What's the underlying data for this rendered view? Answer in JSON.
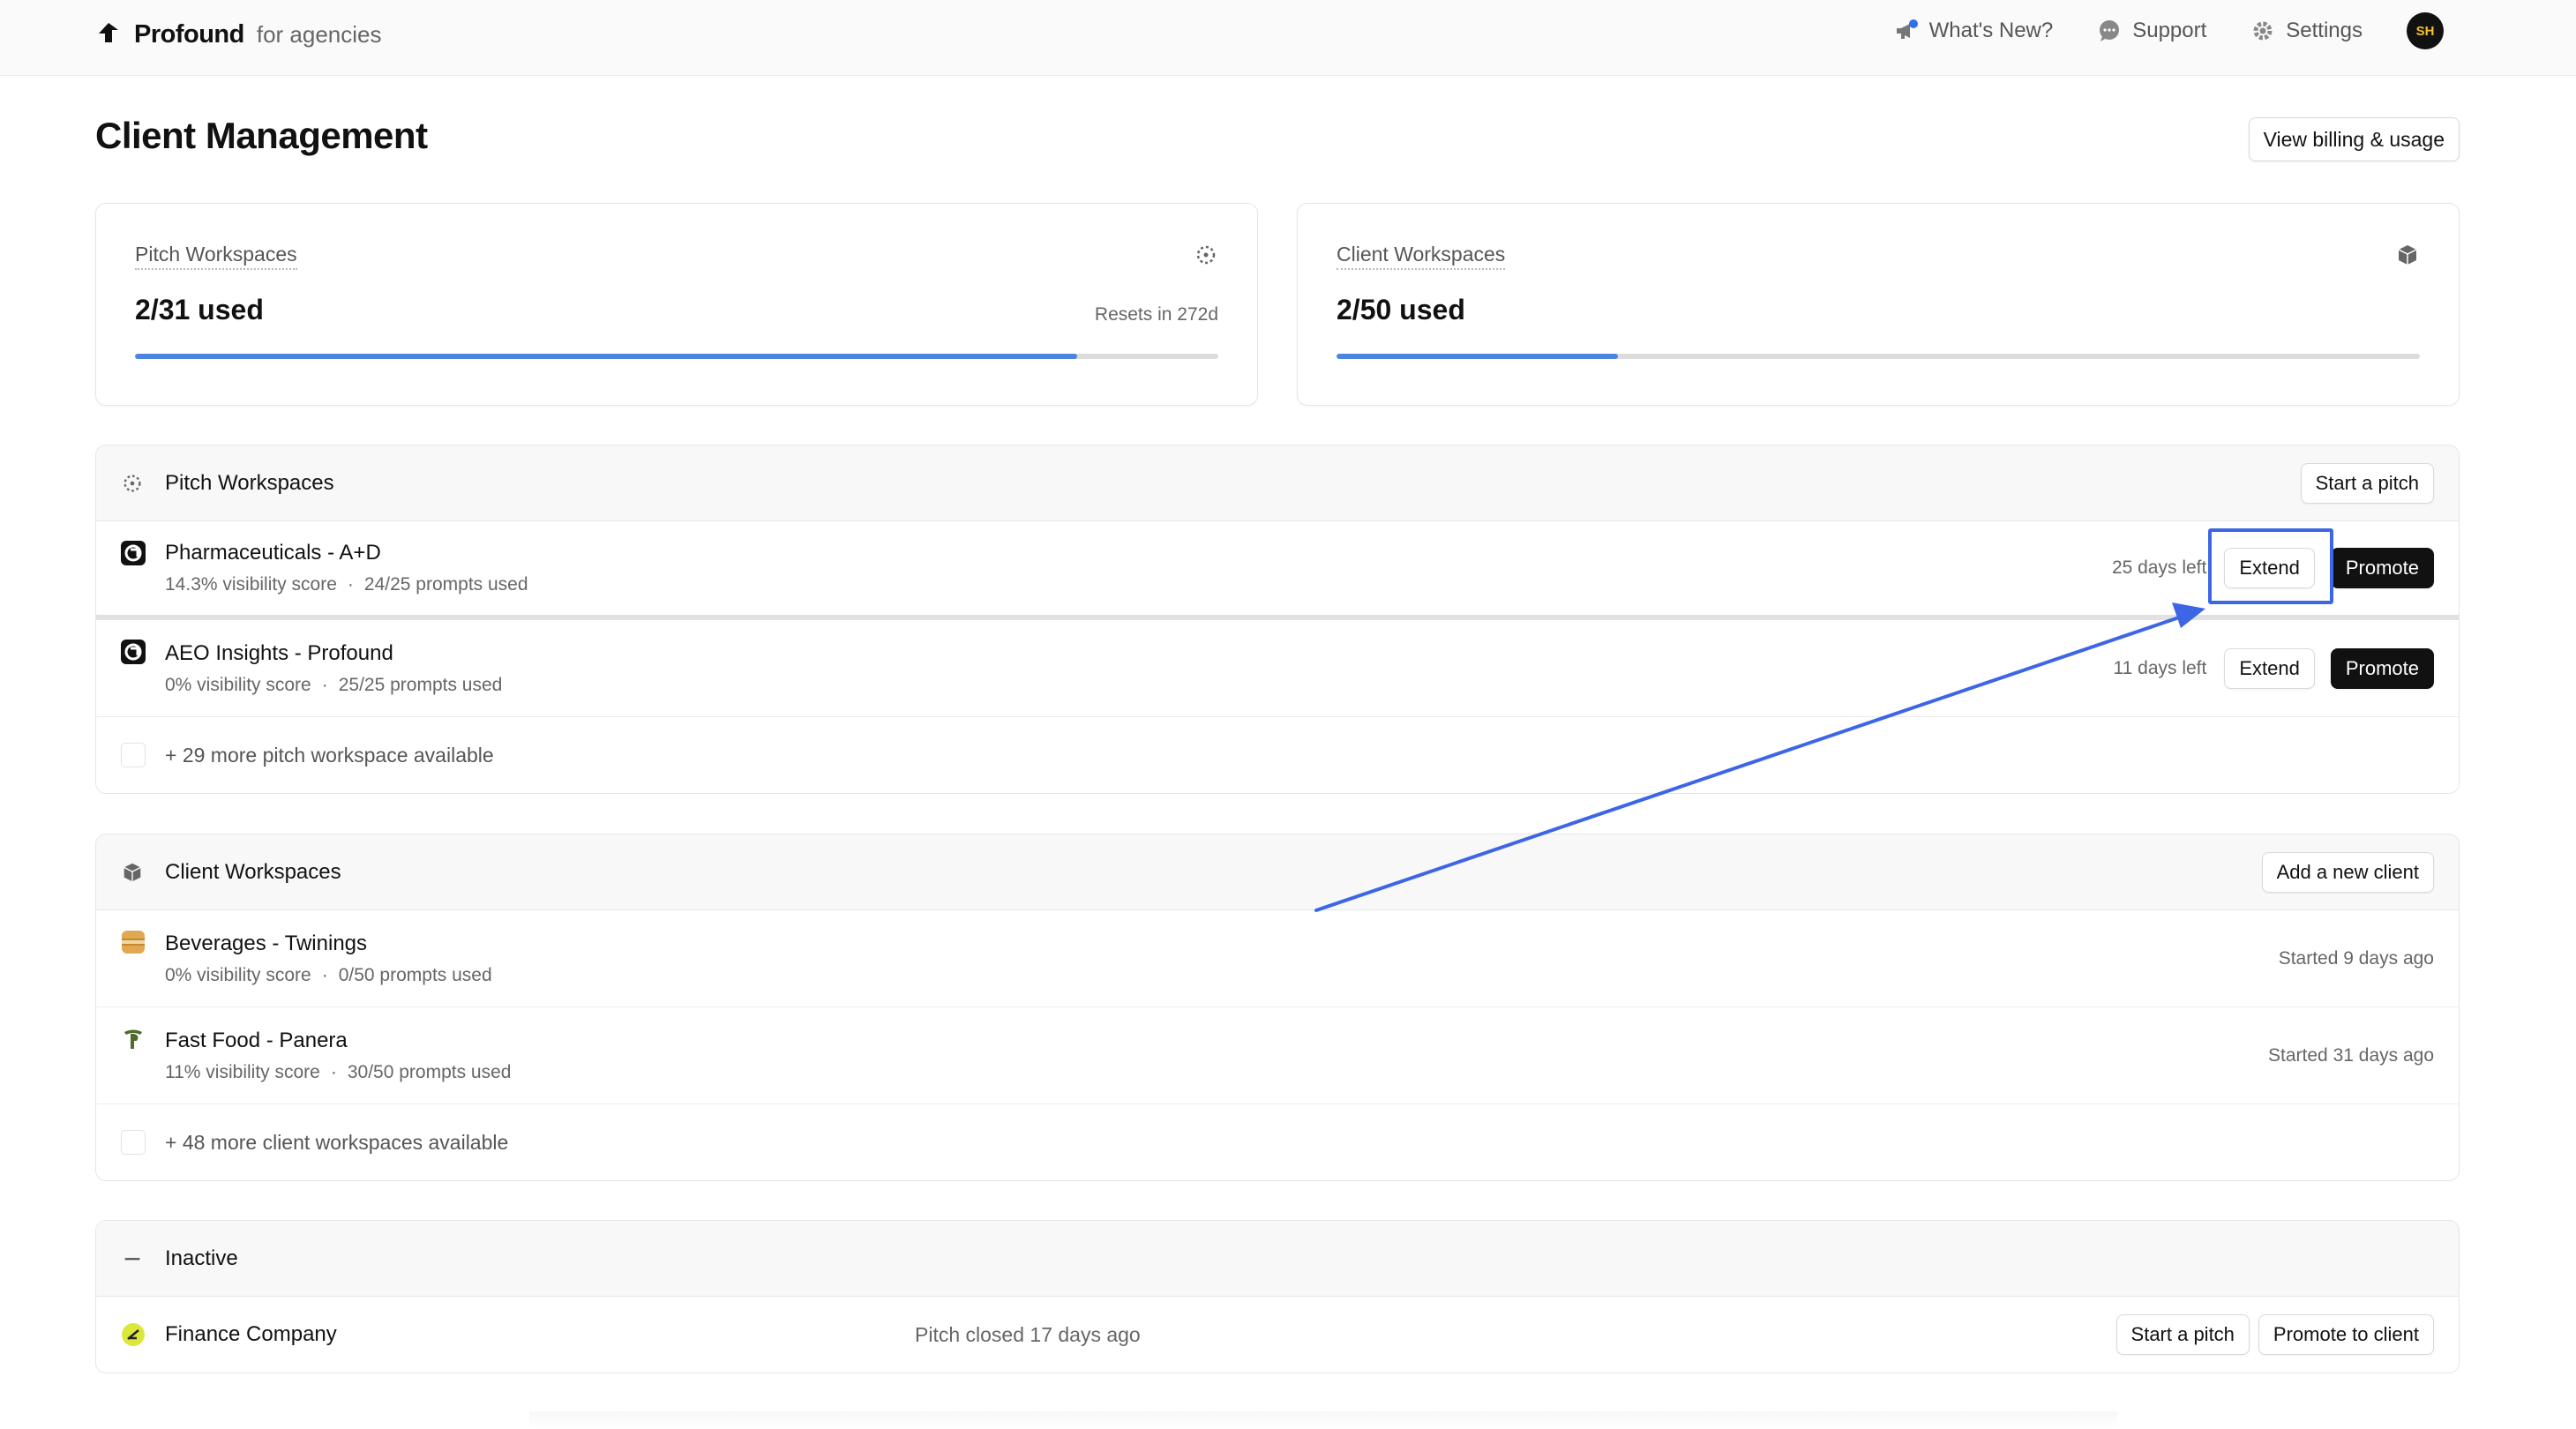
{
  "brand": {
    "name": "Profound",
    "sub": "for agencies"
  },
  "nav": {
    "whats_new": "What's New?",
    "support": "Support",
    "settings": "Settings",
    "avatar_initials": "SH"
  },
  "page": {
    "title": "Client Management",
    "billing_button": "View billing & usage"
  },
  "usage": {
    "pitch": {
      "title": "Pitch Workspaces",
      "value": "2/31 used",
      "reset": "Resets in 272d",
      "fill_percent": 87
    },
    "client": {
      "title": "Client Workspaces",
      "value": "2/50 used",
      "fill_percent": 26
    }
  },
  "pitch_section": {
    "title": "Pitch Workspaces",
    "action": "Start a pitch",
    "rows": [
      {
        "name": "Pharmaceuticals - A+D",
        "visibility": "14.3% visibility score",
        "prompts": "24/25 prompts used",
        "days_left": "25 days left",
        "extend": "Extend",
        "promote": "Promote"
      },
      {
        "name": "AEO Insights - Profound",
        "visibility": "0% visibility score",
        "prompts": "25/25 prompts used",
        "days_left": "11 days left",
        "extend": "Extend",
        "promote": "Promote"
      }
    ],
    "more": "+ 29 more pitch workspace available"
  },
  "client_section": {
    "title": "Client Workspaces",
    "action": "Add a new client",
    "rows": [
      {
        "name": "Beverages - Twinings",
        "visibility": "0% visibility score",
        "prompts": "0/50 prompts used",
        "started": "Started 9 days ago"
      },
      {
        "name": "Fast Food - Panera",
        "visibility": "11% visibility score",
        "prompts": "30/50 prompts used",
        "started": "Started 31 days ago"
      }
    ],
    "more": "+ 48 more client workspaces available"
  },
  "inactive_section": {
    "title": "Inactive",
    "rows": [
      {
        "name": "Finance Company",
        "status": "Pitch closed 17 days ago",
        "start_pitch": "Start a pitch",
        "promote_client": "Promote to client"
      }
    ]
  },
  "colors": {
    "accent": "#4a86e0",
    "annotation": "#3d66e6",
    "dark_button": "#111111"
  }
}
